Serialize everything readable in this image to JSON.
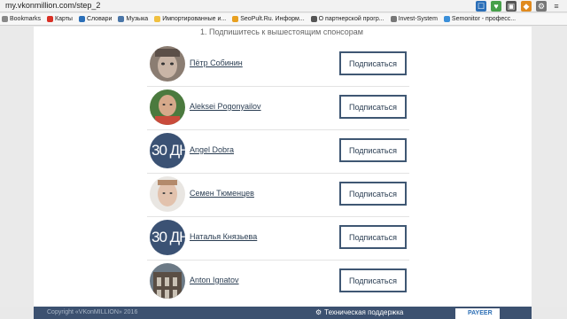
{
  "browser": {
    "url": "my.vkonmillion.com/step_2"
  },
  "bookmarks": [
    {
      "label": "Bookmarks",
      "color": "#888888"
    },
    {
      "label": "Карты",
      "color": "#d93025"
    },
    {
      "label": "Словари",
      "color": "#2b6fb8"
    },
    {
      "label": "Музыка",
      "color": "#4a76a8"
    },
    {
      "label": "Импортированные и...",
      "color": "#f0c040"
    },
    {
      "label": "SeoPult.Ru. Информ...",
      "color": "#e8a020"
    },
    {
      "label": "О партнерской прогр...",
      "color": "#555555"
    },
    {
      "label": "Invest-System",
      "color": "#777777"
    },
    {
      "label": "Semonitor - професс...",
      "color": "#3b8fd9"
    }
  ],
  "page": {
    "step_heading": "1. Подпишитесь к вышестоящим спонсорам",
    "thirty_label": "30 ДН"
  },
  "sponsors": [
    {
      "name": "Пётр Собинин",
      "button": "Подписаться",
      "avatar": "photo-face"
    },
    {
      "name": "Aleksei Pogonyailov",
      "button": "Подписаться",
      "avatar": "photo-face"
    },
    {
      "name": "Angel Dobra",
      "button": "Подписаться",
      "avatar": "thirty-days"
    },
    {
      "name": "Семен Тюменцев",
      "button": "Подписаться",
      "avatar": "photo-face"
    },
    {
      "name": "Наталья Князьева",
      "button": "Подписаться",
      "avatar": "thirty-days"
    },
    {
      "name": "Anton Ignatov",
      "button": "Подписаться",
      "avatar": "photo-building"
    }
  ],
  "footer": {
    "copyright": "Copyright «VKonMILLION» 2016",
    "support": "Техническая поддержка",
    "payeer": "PAYEER"
  },
  "colors": {
    "accent": "#3f5773",
    "footer_bg": "#3c5170"
  }
}
